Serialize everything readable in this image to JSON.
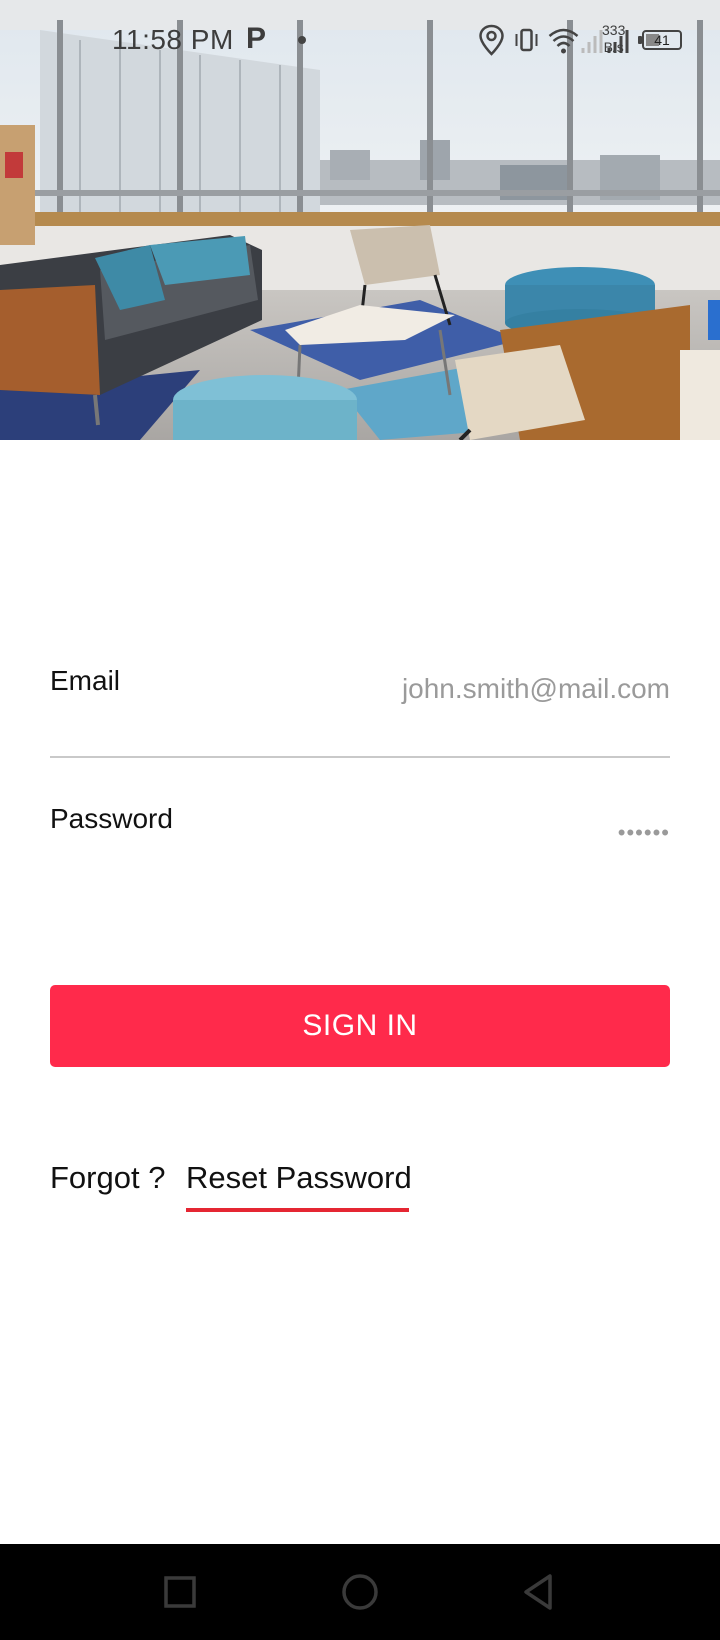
{
  "status_bar": {
    "time": "11:58 PM",
    "p_icon_label": "P",
    "speed_value": "333",
    "speed_unit": "B/s",
    "battery_level": "41",
    "battery_fraction": 0.41
  },
  "hero": {
    "icon": "office-lounge-photo"
  },
  "form": {
    "email_label": "Email",
    "email_value": "john.smith@mail.com",
    "password_label": "Password",
    "password_value": "••••••"
  },
  "actions": {
    "sign_in_label": "SIGN IN",
    "forgot_label": "Forgot ?",
    "reset_label": "Reset Password"
  },
  "colors": {
    "accent": "#ff2a4b",
    "underline": "#e52632",
    "nav_bg": "#000000"
  },
  "nav_bar": {
    "icons": [
      "square-recents-icon",
      "circle-home-icon",
      "triangle-back-icon"
    ]
  }
}
